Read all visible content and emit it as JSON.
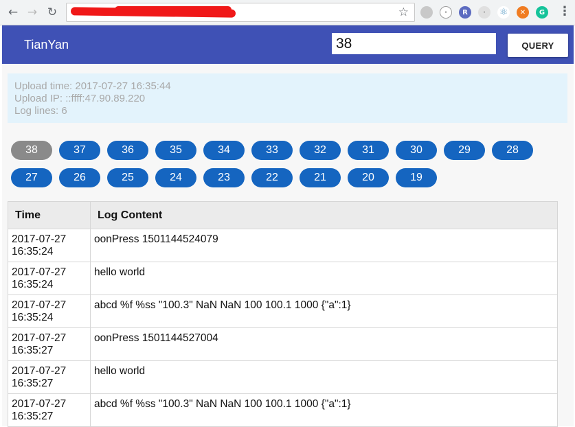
{
  "app": {
    "title": "TianYan"
  },
  "search": {
    "value": "38",
    "button_label": "QUERY"
  },
  "info": {
    "upload_time": "Upload time: 2017-07-27 16:35:44",
    "upload_ip": "Upload IP: ::ffff:47.90.89.220",
    "log_lines": "Log lines: 6"
  },
  "log_ids": {
    "active": "38",
    "row1": [
      "38",
      "37",
      "36",
      "35",
      "34",
      "33",
      "32",
      "31",
      "30",
      "29",
      "28"
    ],
    "row2": [
      "27",
      "26",
      "25",
      "24",
      "23",
      "22",
      "21",
      "20",
      "19"
    ]
  },
  "table": {
    "headers": [
      "Time",
      "Log Content"
    ],
    "rows": [
      {
        "date": "2017-07-27",
        "time": "16:35:24",
        "content": "oonPress 1501144524079"
      },
      {
        "date": "2017-07-27",
        "time": "16:35:24",
        "content": "hello world"
      },
      {
        "date": "2017-07-27",
        "time": "16:35:24",
        "content": "abcd %f %ss \"100.3\" NaN NaN 100 100.1 1000 {\"a\":1}"
      },
      {
        "date": "2017-07-27",
        "time": "16:35:27",
        "content": "oonPress 1501144527004"
      },
      {
        "date": "2017-07-27",
        "time": "16:35:27",
        "content": "hello world"
      },
      {
        "date": "2017-07-27",
        "time": "16:35:27",
        "content": "abcd %f %ss \"100.3\" NaN NaN 100 100.1 1000 {\"a\":1}"
      }
    ]
  },
  "colors": {
    "header": "#3f51b5",
    "chip": "#1565c0",
    "chip_active": "#8a8a8a",
    "info_bg": "#e3f3fc"
  },
  "icons": [
    "back-arrow-icon",
    "forward-arrow-icon",
    "reload-icon",
    "star-icon",
    "menu-dots-icon"
  ]
}
